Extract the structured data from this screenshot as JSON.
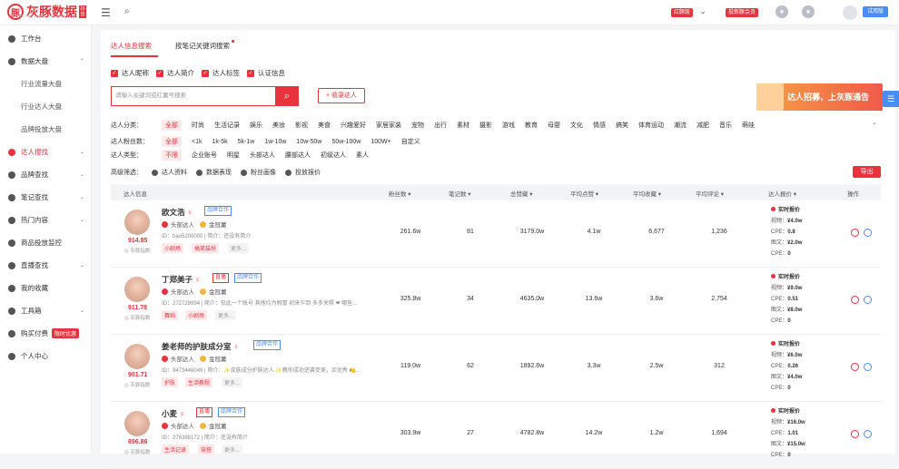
{
  "brand": {
    "name": "灰豚数据",
    "badge": "抖音",
    "sub": "HUI DUN DATA · BIG DATA"
  },
  "top": {
    "vip": "红豚版",
    "promo": "投新豚会员",
    "trial": "试用版"
  },
  "sidebar": [
    {
      "label": "工作台",
      "active": false
    },
    {
      "label": "数据大盘",
      "active": false,
      "expanded": true
    },
    {
      "label": "行业流量大盘",
      "sub": true
    },
    {
      "label": "行业达人大盘",
      "sub": true
    },
    {
      "label": "品牌投放大盘",
      "sub": true
    },
    {
      "label": "达人搜找",
      "active": true
    },
    {
      "label": "品牌查找"
    },
    {
      "label": "笔记查找"
    },
    {
      "label": "热门内容"
    },
    {
      "label": "商品投放监控"
    },
    {
      "label": "直播查找"
    },
    {
      "label": "我的收藏"
    },
    {
      "label": "工具箱"
    },
    {
      "label": "购买付费",
      "badge": "限时优惠"
    },
    {
      "label": "个人中心"
    }
  ],
  "tabs": [
    "达人信息搜索",
    "按笔记关键词搜索"
  ],
  "checkboxes": [
    "达人昵称",
    "达人简介",
    "达人标签",
    "认证信息"
  ],
  "search": {
    "placeholder": "请输入关键词或红薯号搜索",
    "collect": "+ 收录达人"
  },
  "banner": "达人招募，上灰豚通告",
  "filters": {
    "category": {
      "label": "达人分类：",
      "options": [
        "全部",
        "时尚",
        "生活记录",
        "娱乐",
        "美妆",
        "影视",
        "美食",
        "兴趣爱好",
        "家居家装",
        "宠物",
        "出行",
        "素材",
        "摄影",
        "游戏",
        "教育",
        "母婴",
        "文化",
        "情感",
        "搞笑",
        "体育运动",
        "潮流",
        "减肥",
        "音乐",
        "萌娃"
      ]
    },
    "fans": {
      "label": "达人粉丝数：",
      "options": [
        "全部",
        "<1k",
        "1k-5k",
        "5k-1w",
        "1w-10w",
        "10w-50w",
        "50w-100w",
        "100W+",
        "自定义"
      ]
    },
    "type": {
      "label": "达人类型：",
      "options": [
        "不限",
        "企业账号",
        "明星",
        "头部达人",
        "腰部达人",
        "初级达人",
        "素人"
      ]
    }
  },
  "advanced": {
    "label": "高级筛选：",
    "items": [
      "达人资料",
      "数据表现",
      "粉丝画像",
      "投放报价"
    ]
  },
  "export": "导出",
  "columns": [
    "达人信息",
    "粉丝数",
    "笔记数",
    "总赞藏",
    "平均点赞",
    "平均收藏",
    "平均评论",
    "达人报价",
    "操作"
  ],
  "rows": [
    {
      "name": "欧文浩",
      "tags": [
        "品牌合作"
      ],
      "plat": "头部达人",
      "level": "金冠薯",
      "id": "ID：hao5200000 | 简介：还没有简介",
      "ctags": [
        "小剧场",
        "搞笑装扮",
        "更多..."
      ],
      "score": "914.85",
      "score_label": "灰豚指数",
      "fans": "261.6w",
      "notes": "81",
      "likes": "3179.0w",
      "avg_like": "4.1w",
      "avg_fav": "6,677",
      "avg_com": "1,236",
      "price_title": "实时报价",
      "p1": "视频：",
      "v1": "¥4.0w",
      "p2": "CPE：",
      "v2": "0.8",
      "p3": "图文：",
      "v3": "¥2.0w",
      "p4": "CPE：",
      "v4": "0"
    },
    {
      "name": "丁郑美子",
      "tags": [
        "直播",
        "品牌合作"
      ],
      "plat": "头部达人",
      "level": "金冠薯",
      "id": "ID：272729994 | 简介：仅此一个账号 其他均为假冒 初来乍到 多多关照 ❤ 哪些...",
      "ctags": [
        "舞蹈",
        "小剧场",
        "更多..."
      ],
      "score": "911.78",
      "score_label": "灰豚指数",
      "fans": "325.8w",
      "notes": "34",
      "likes": "4635.0w",
      "avg_like": "13.6w",
      "avg_fav": "3.6w",
      "avg_com": "2,754",
      "price_title": "实时报价",
      "p1": "视频：",
      "v1": "¥9.0w",
      "p2": "CPE：",
      "v2": "0.51",
      "p3": "图文：",
      "v3": "¥8.0w",
      "p4": "CPE：",
      "v4": "0"
    },
    {
      "name": "姜老师的护肤成分室",
      "tags": [
        "品牌合作"
      ],
      "plat": "头部达人",
      "level": "金冠薯",
      "id": "ID：9473446049 | 简介：✨皮肤成分护肤达人 ✨教你成功逆袭变美，买优秀 🍋...",
      "ctags": [
        "护肤",
        "生活教程",
        "更多..."
      ],
      "score": "901.71",
      "score_label": "灰豚指数",
      "fans": "119.0w",
      "notes": "62",
      "likes": "1892.6w",
      "avg_like": "3.3w",
      "avg_fav": "2.5w",
      "avg_com": "312",
      "price_title": "实时报价",
      "p1": "视频：",
      "v1": "¥6.0w",
      "p2": "CPE：",
      "v2": "0.26",
      "p3": "图文：",
      "v3": "¥4.0w",
      "p4": "CPE：",
      "v4": "0"
    },
    {
      "name": "小麦",
      "tags": [
        "直播",
        "品牌合作"
      ],
      "plat": "头部达人",
      "level": "金冠薯",
      "id": "ID：276388172 | 简介：还没有简介",
      "ctags": [
        "生活记录",
        "穿搭",
        "更多..."
      ],
      "score": "896.86",
      "score_label": "灰豚指数",
      "fans": "303.9w",
      "notes": "27",
      "likes": "4782.8w",
      "avg_like": "14.2w",
      "avg_fav": "1.2w",
      "avg_com": "1,694",
      "price_title": "实时报价",
      "p1": "视频：",
      "v1": "¥16.0w",
      "p2": "CPE：",
      "v2": "1.01",
      "p3": "图文：",
      "v3": "¥15.0w",
      "p4": "CPE：",
      "v4": "0"
    }
  ]
}
